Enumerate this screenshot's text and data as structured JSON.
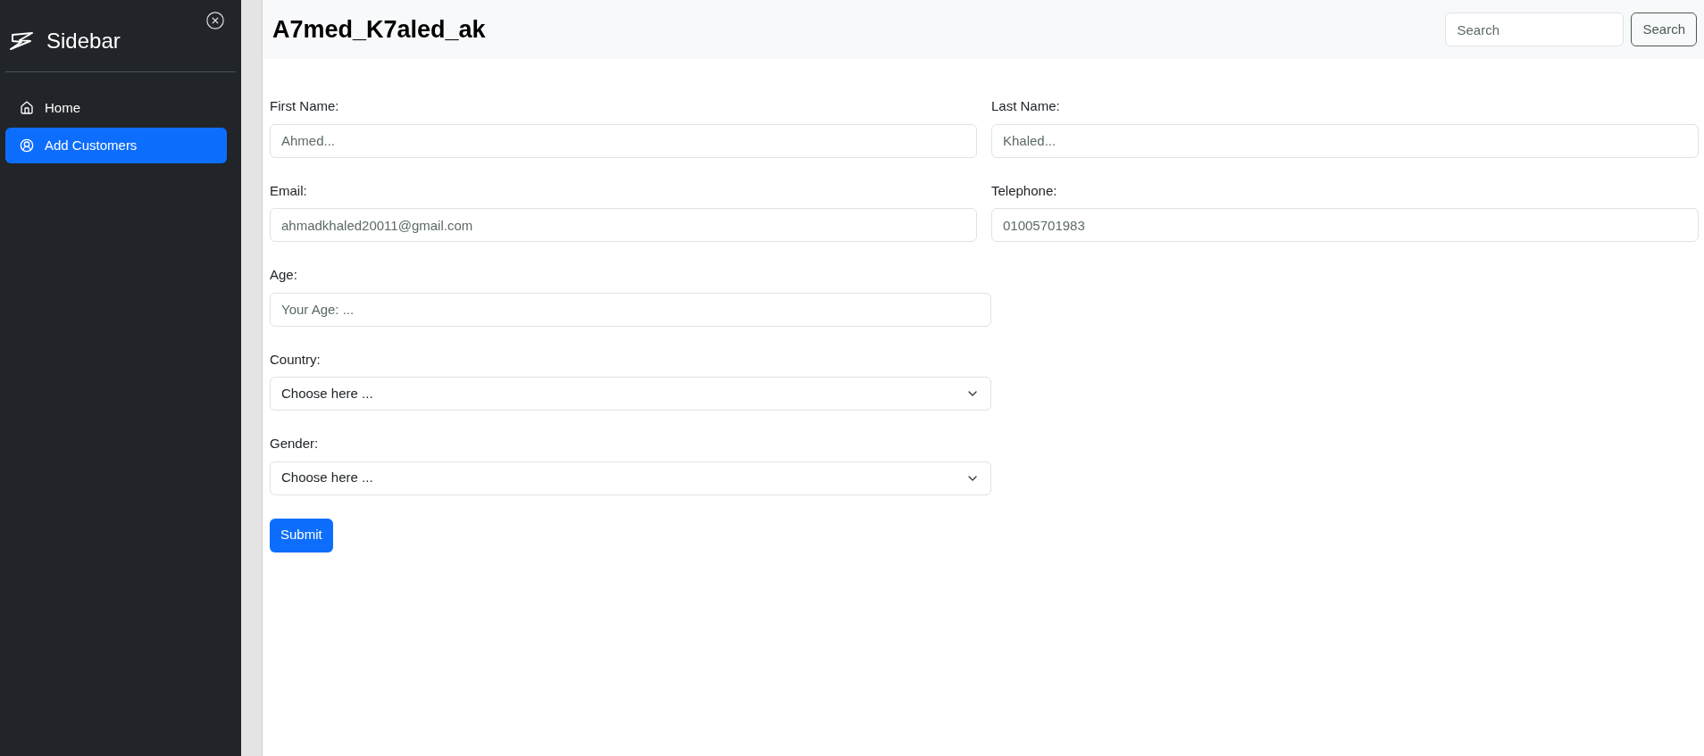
{
  "sidebar": {
    "title": "Sidebar",
    "items": [
      {
        "label": "Home",
        "selected": false
      },
      {
        "label": "Add Customers",
        "selected": true
      }
    ]
  },
  "header": {
    "title": "A7med_K7aled_ak",
    "search": {
      "placeholder": "Search"
    },
    "search_button": "Search"
  },
  "form": {
    "rows": [
      [
        {
          "label": "First Name:",
          "kind": "input",
          "placeholder": "Ahmed..."
        },
        {
          "label": "Last Name:",
          "kind": "input",
          "placeholder": "Khaled..."
        }
      ],
      [
        {
          "label": "Email:",
          "kind": "input",
          "placeholder": "ahmadkhaled20011@gmail.com"
        },
        {
          "label": "Telephone:",
          "kind": "input",
          "placeholder": "01005701983"
        }
      ],
      [
        {
          "label": "Age:",
          "kind": "input",
          "placeholder": "Your Age: ..."
        }
      ],
      [
        {
          "label": "Country:",
          "kind": "select",
          "value": "Choose here ..."
        }
      ],
      [
        {
          "label": "Gender:",
          "kind": "select",
          "value": "Choose here ..."
        }
      ]
    ],
    "submit": "Submit"
  }
}
